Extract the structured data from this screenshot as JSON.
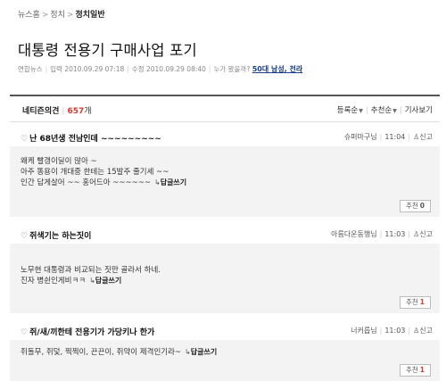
{
  "breadcrumb": {
    "items": [
      "뉴스홈",
      "정치"
    ],
    "current": "정치일반",
    "separator": ">"
  },
  "article": {
    "title": "대통령 전용기 구매사업 포기",
    "source": "연합뉴스",
    "posted": "입력 2010.09.29 07:18",
    "edited": "수정 2010.09.29 08:40",
    "who_read_label": "누가 봤을까?",
    "who_read_link": "50대 남성, 전라"
  },
  "comments_section": {
    "label": "네티즌의견",
    "count": "657",
    "count_unit": "개",
    "sort_options": [
      "등록순",
      "추천순"
    ],
    "view_article": "기사보기"
  },
  "comments": [
    {
      "title": "난 68년생 전남인데 ~~~~~~~~~",
      "author": "슈퍼마구님",
      "time": "11:04",
      "report": "신고",
      "lines": [
        "왜케 빨갱이딜이 많아 ~",
        "아주 똥용이 개대중 한테는 15발주 줄기세 ~~",
        "인간 답게살어 ~~ 홍어드아 ~~~~~~"
      ],
      "reply_label": "답글쓰기",
      "recommend_label": "추천",
      "recommend_count": "0"
    },
    {
      "title": "쥐색기는 하는짓이",
      "author": "아름다운동행님",
      "time": "11:03",
      "report": "신고",
      "lines": [
        "노무현 대통령과 비교되는 짓만 골라서 하네.",
        "진자 병쉰인게비ㅋㅋ"
      ],
      "reply_label": "답글쓰기",
      "recommend_label": "추천",
      "recommend_count": "1"
    },
    {
      "title": "쥐/새/끼한테 전용기가 가당키나 한가",
      "author": "너커릅님",
      "time": "11:03",
      "report": "신고",
      "lines": [
        "쥐돌무, 쥐덫, 찍찍이, 끈끈이, 쥐약이 제격인기라~"
      ],
      "reply_label": "답글쓰기",
      "recommend_label": "추천",
      "recommend_count": "1"
    }
  ],
  "icons": {
    "comment_bubble": "speech-bubble-icon",
    "report": "siren-icon",
    "reply_arrow": "reply-arrow-icon",
    "sort_caret": "caret-down-icon"
  },
  "colors": {
    "accent_red": "#d63a2f",
    "link_blue": "#1a3d8f",
    "comment_bg": "#f3f3f3"
  }
}
